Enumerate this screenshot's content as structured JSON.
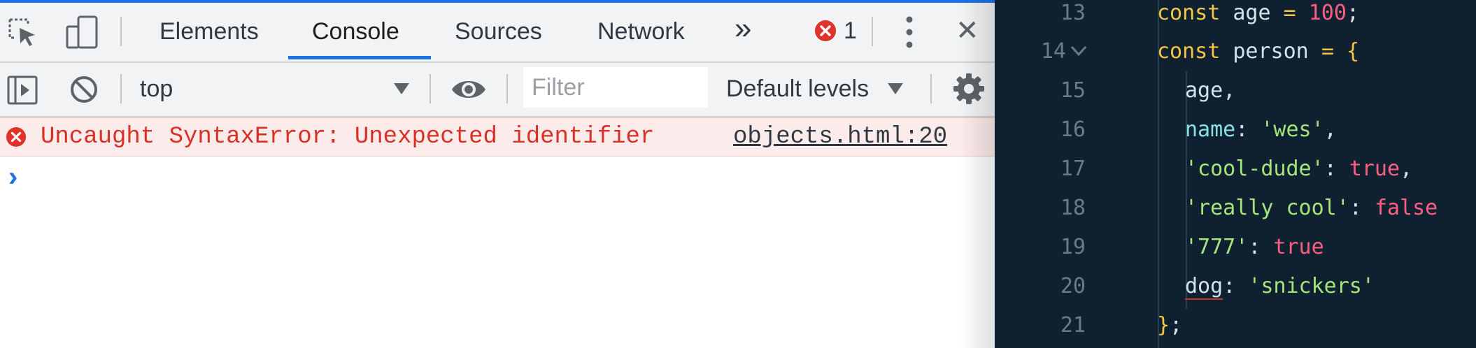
{
  "devtools": {
    "tabs": [
      "Elements",
      "Console",
      "Sources",
      "Network"
    ],
    "active_tab": "Console",
    "more_tabs_glyph": "»",
    "error_count": "1",
    "close_glyph": "✕",
    "context": "top",
    "filter_placeholder": "Filter",
    "levels": "Default levels",
    "error": {
      "message": "Uncaught SyntaxError: Unexpected identifier",
      "source": "objects.html:20"
    },
    "prompt": "›",
    "colors": {
      "accent": "#1a73e8",
      "error": "#d93025",
      "error_bg": "#fcebeb"
    }
  },
  "editor": {
    "line_numbers": [
      "13",
      "14",
      "15",
      "16",
      "17",
      "18",
      "19",
      "20",
      "21"
    ],
    "lines": {
      "l13": {
        "kw": "const",
        "name": "age",
        "eq": "=",
        "val": "100",
        "end": ";"
      },
      "l14": {
        "kw": "const",
        "name": "person",
        "eq": "=",
        "brace": "{"
      },
      "l15": {
        "prop": "age",
        "end": ","
      },
      "l16": {
        "prop": "name",
        "colon": ":",
        "str": "'wes'",
        "end": ","
      },
      "l17": {
        "str": "'cool-dude'",
        "colon": ":",
        "val": "true",
        "end": ","
      },
      "l18": {
        "str": "'really cool'",
        "colon": ":",
        "val": "false"
      },
      "l19": {
        "str": "'777'",
        "colon": ":",
        "val": "true"
      },
      "l20": {
        "prop": "dog",
        "colon": ":",
        "str": "'snickers'"
      },
      "l21": {
        "brace": "}",
        "end": ";"
      }
    },
    "fold_glyph": "⌄",
    "colors": {
      "background": "#0f2130",
      "keyword": "#f5c542",
      "string": "#a5e57a",
      "boolean": "#ff5e82",
      "property": "#88e1e6"
    }
  }
}
